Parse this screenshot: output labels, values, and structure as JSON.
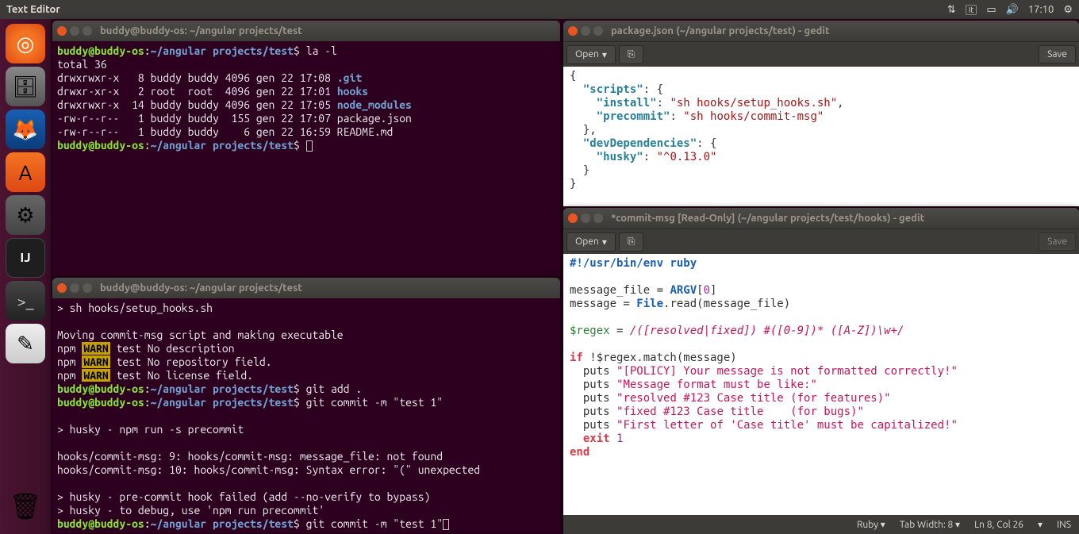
{
  "topbar": {
    "title": "Text Editor",
    "lang": "It",
    "time": "17:10"
  },
  "term1": {
    "title": "buddy@buddy-os: ~/angular projects/test",
    "prompt_user": "buddy@buddy-os",
    "prompt_path": "~/angular projects/test",
    "cmd1": "la -l",
    "total": "total 36",
    "rows": [
      {
        "perm": "drwxrwxr-x",
        "n": "  8",
        "u": "buddy",
        "g": "buddy",
        "s": "4096",
        "d": "gen 22 17:08",
        "f": ".git",
        "link": true
      },
      {
        "perm": "drwxr-xr-x",
        "n": "  2",
        "u": "root ",
        "g": "root ",
        "s": "4096",
        "d": "gen 22 17:01",
        "f": "hooks",
        "link": true
      },
      {
        "perm": "drwxrwxr-x",
        "n": " 14",
        "u": "buddy",
        "g": "buddy",
        "s": "4096",
        "d": "gen 22 17:05",
        "f": "node_modules",
        "link": true
      },
      {
        "perm": "-rw-r--r--",
        "n": "  1",
        "u": "buddy",
        "g": "buddy",
        "s": " 155",
        "d": "gen 22 17:07",
        "f": "package.json",
        "link": false
      },
      {
        "perm": "-rw-r--r--",
        "n": "  1",
        "u": "buddy",
        "g": "buddy",
        "s": "   6",
        "d": "gen 22 16:59",
        "f": "README.md",
        "link": false
      }
    ]
  },
  "term2": {
    "title": "buddy@buddy-os: ~/angular projects/test",
    "cmd_sh": "> sh hooks/setup_hooks.sh",
    "moving": "Moving commit-msg script and making executable",
    "npm_label": "npm",
    "warn_label": "WARN",
    "warn1": " test No description",
    "warn2": " test No repository field.",
    "warn3": " test No license field.",
    "git_add": "git add .",
    "git_commit": "git commit -m \"test 1\"",
    "husky_run": "> husky - npm run -s precommit",
    "err1": "hooks/commit-msg: 9: hooks/commit-msg: message_file: not found",
    "err2": "hooks/commit-msg: 10: hooks/commit-msg: Syntax error: \"(\" unexpected",
    "husky_fail": "> husky - pre-commit hook failed (add --no-verify to bypass)",
    "husky_debug": "> husky - to debug, use 'npm run precommit'"
  },
  "gedit1": {
    "title": "package.json (~/angular projects/test) - gedit",
    "open": "Open",
    "save": "Save",
    "json": {
      "scripts_key": "\"scripts\"",
      "install_key": "\"install\"",
      "install_val": "\"sh hooks/setup_hooks.sh\"",
      "precommit_key": "\"precommit\"",
      "precommit_val": "\"sh hooks/commit-msg\"",
      "dev_key": "\"devDependencies\"",
      "husky_key": "\"husky\"",
      "husky_val": "\"^0.13.0\""
    }
  },
  "gedit2": {
    "title": "*commit-msg [Read-Only] (~/angular projects/test/hooks) - gedit",
    "open": "Open",
    "save": "Save",
    "ruby": {
      "shebang": "#!/usr/bin/env ruby",
      "l1a": "message_file = ",
      "argv": "ARGV",
      "zero": "0",
      "l2a": "message = ",
      "file": "File",
      "read": ".read(message_file)",
      "regex_var": "$regex",
      "regex_eq": " = ",
      "regex_val": "/([resolved|fixed]) #([0-9])* ([A-Z])\\w+/",
      "if_kw": "if",
      "not_match": " !$regex.match(message)",
      "p1": "\"[POLICY] Your message is not formatted correctly!\"",
      "p2": "\"Message format must be like:\"",
      "p3": "\"resolved #123 Case title (for features)\"",
      "p4": "\"fixed #123 Case title    (for bugs)\"",
      "p5": "\"First letter of 'Case title' must be capitalized!\"",
      "puts": "puts",
      "exit_kw": "exit",
      "one": "1",
      "end_kw": "end"
    },
    "status": {
      "lang": "Ruby",
      "tab": "Tab Width: 8",
      "pos": "Ln 8, Col 26",
      "ins": "INS"
    }
  }
}
